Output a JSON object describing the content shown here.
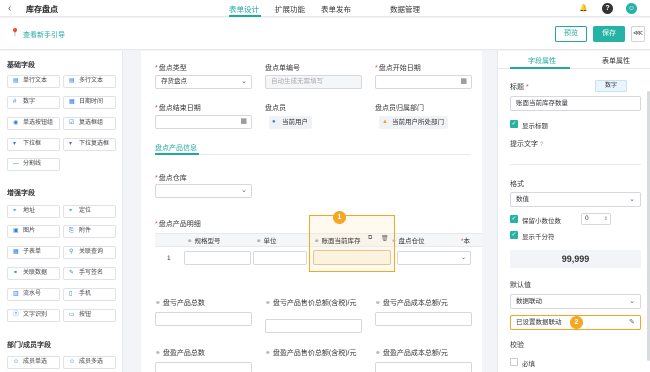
{
  "colors": {
    "accent": "#1fa99b",
    "highlight": "#f5a623",
    "required": "#e2453c"
  },
  "topbar": {
    "back_icon": "‹",
    "title": "库存盘点",
    "tabs": [
      "表单设计",
      "扩展功能",
      "表单发布",
      "数据管理"
    ],
    "active_tab": "表单设计",
    "icons": {
      "bell": "🔔",
      "help": "?",
      "avatar": "☺"
    }
  },
  "guidebar": {
    "icon": "📍",
    "link": "查看新手引导",
    "preview_label": "预览",
    "save_label": "保存",
    "share_icon": "⋘"
  },
  "left_panel": {
    "groups": [
      {
        "title": "基础字段",
        "items": [
          {
            "icon": "▤",
            "label": "单行文本"
          },
          {
            "icon": "▤",
            "label": "多行文本"
          },
          {
            "icon": "#",
            "label": "数字"
          },
          {
            "icon": "▦",
            "label": "日期时间"
          },
          {
            "icon": "◉",
            "label": "单选按钮组"
          },
          {
            "icon": "☑",
            "label": "复选框组"
          },
          {
            "icon": "▾",
            "label": "下拉框"
          },
          {
            "icon": "▾",
            "label": "下拉复选框"
          },
          {
            "icon": "—",
            "label": "分割线"
          }
        ]
      },
      {
        "title": "增强字段",
        "items": [
          {
            "icon": "⌖",
            "label": "地址"
          },
          {
            "icon": "⌖",
            "label": "定位"
          },
          {
            "icon": "▣",
            "label": "图片"
          },
          {
            "icon": "⎘",
            "label": "附件"
          },
          {
            "icon": "▦",
            "label": "子表单"
          },
          {
            "icon": "⚲",
            "label": "关联查询"
          },
          {
            "icon": "⚭",
            "label": "关联数据"
          },
          {
            "icon": "✎",
            "label": "手写签名"
          },
          {
            "icon": "▥",
            "label": "流水号"
          },
          {
            "icon": "▯",
            "label": "手机"
          },
          {
            "icon": "Ⓣ",
            "label": "文字识别"
          },
          {
            "icon": "▭",
            "label": "按钮"
          }
        ]
      },
      {
        "title": "部门/成员字段",
        "items": [
          {
            "icon": "☺",
            "label": "成员单选"
          },
          {
            "icon": "☺",
            "label": "成员多选"
          }
        ]
      }
    ]
  },
  "form": {
    "inventory_type": {
      "label": "盘点类型",
      "value": "存货盘点"
    },
    "doc_no": {
      "label": "盘点单编号",
      "placeholder": "自动生成无需填写"
    },
    "start_date": {
      "label": "盘点开始日期"
    },
    "end_date": {
      "label": "盘点结束日期"
    },
    "counter": {
      "label": "盘点员",
      "value": "当前用户"
    },
    "dept": {
      "label": "盘点员归属部门",
      "value": "当前用户所处部门"
    },
    "section_tab": "盘点产品信息",
    "warehouse": {
      "label": "盘点仓库"
    },
    "detail": {
      "label": "盘点产品明细",
      "columns": [
        "规格型号",
        "单位",
        "账面当前库存",
        "盘点仓位",
        "本"
      ],
      "row_number": "1",
      "badge": "1"
    },
    "totals": [
      {
        "label": "盘亏产品总数"
      },
      {
        "label": "盘亏产品售价总额(含税)/元"
      },
      {
        "label": "盘亏产品成本总额/元"
      },
      {
        "label": "盘盈产品总数"
      },
      {
        "label": "盘盈产品售价总额(含税)/元"
      },
      {
        "label": "盘盈产品成本总额/元"
      }
    ]
  },
  "right_panel": {
    "tabs": [
      "字段属性",
      "表单属性"
    ],
    "active_tab": "字段属性",
    "title_label": "标题",
    "title_value": "账面当前库存数量",
    "type_tag": "数字",
    "show_title": "显示标题",
    "hint_label": "提示文字",
    "format_label": "格式",
    "format_value": "数值",
    "keep_decimals": "保留小数位数",
    "decimals_value": "0",
    "thousands": "显示千分符",
    "preview_value": "99,999",
    "default_label": "默认值",
    "default_value": "数据联动",
    "linkage_button": "已设置数据联动",
    "badge": "2",
    "validate_label": "校验",
    "required": "必填"
  }
}
